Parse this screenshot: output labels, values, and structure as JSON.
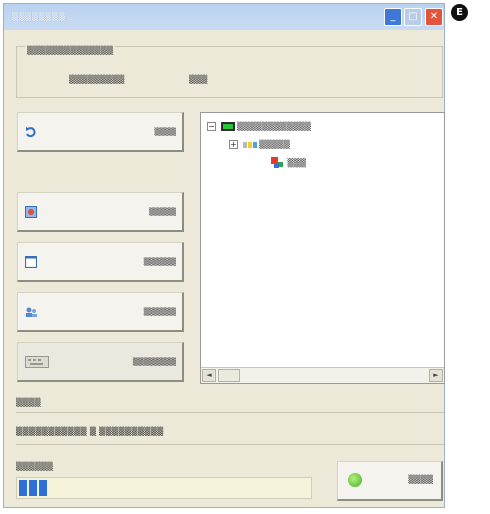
{
  "window": {
    "title": "▒▒▒▒▒▒▒▒",
    "controls": {
      "minimize": "_",
      "maximize": "□",
      "close": "✕"
    },
    "side_badge": "E"
  },
  "group": {
    "title": "▒▒▒▒▒▒▒▒▒▒▒▒▒▒",
    "field_label": "▒▒▒▒▒▒▒▒▒",
    "field_value": "▒▒▒"
  },
  "side_buttons": [
    {
      "label": "▒▒▒▒",
      "icon": "refresh-icon"
    },
    {
      "label": "▒▒▒▒▒",
      "icon": "picture-icon"
    },
    {
      "label": "▒▒▒▒▒▒",
      "icon": "window-icon"
    },
    {
      "label": "▒▒▒▒▒▒",
      "icon": "users-icon"
    },
    {
      "label": "▒▒▒▒▒▒▒▒",
      "icon": "keyboard-icon"
    }
  ],
  "tree": {
    "items": [
      {
        "label": "▒▒▒▒▒▒▒▒▒▒▒▒",
        "expander": "−"
      },
      {
        "label": "▒▒▒▒▒",
        "expander": "+"
      },
      {
        "label": "▒▒▒",
        "expander": ""
      }
    ],
    "scroll_left": "◄",
    "scroll_right": "►"
  },
  "status": {
    "label": "▒▒▒▒",
    "text": "▒▒▒▒▒▒▒▒▒▒▒ ▒ ▒▒▒▒▒▒▒▒▒▒"
  },
  "progress": {
    "label": "▒▒▒▒▒▒",
    "value_fraction": 0.09
  },
  "action": {
    "label": "▒▒▒▒",
    "icon": "go-icon"
  },
  "colors": {
    "titlebar": "#b9d3f0",
    "window_bg": "#ece9d8",
    "progress_fill": "#2f6fd8",
    "close_button": "#e2543c",
    "go_icon": "#3fb01f"
  }
}
